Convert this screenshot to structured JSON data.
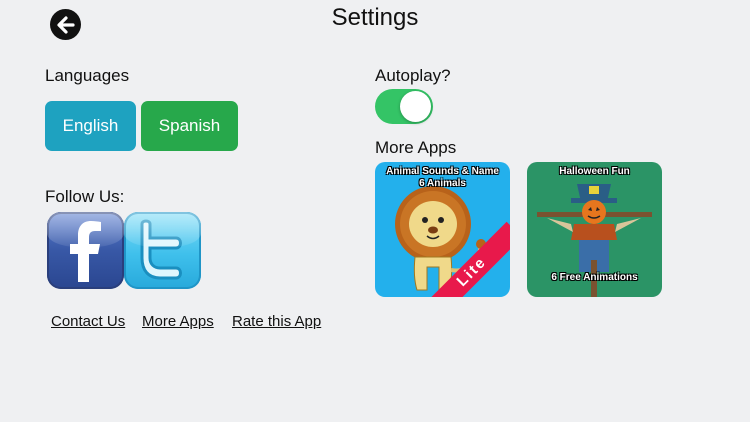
{
  "header": {
    "title": "Settings"
  },
  "languages": {
    "label": "Languages",
    "options": [
      "English",
      "Spanish"
    ]
  },
  "follow": {
    "label": "Follow Us:"
  },
  "links": [
    "Contact Us",
    "More Apps",
    "Rate this App"
  ],
  "autoplay": {
    "label": "Autoplay?",
    "enabled": true
  },
  "more_apps": {
    "label": "More Apps",
    "apps": [
      {
        "line1": "Animal Sounds & Name",
        "line2": "6 Animals",
        "ribbon": "Lite"
      },
      {
        "line1": "Halloween Fun",
        "line2": "6 Free Animations"
      }
    ]
  },
  "colors": {
    "background": "#eff0f2",
    "english_button": "#1ea2c0",
    "spanish_button": "#27a84b",
    "toggle_on": "#34c466"
  },
  "icons": [
    "back-arrow-icon",
    "facebook-icon",
    "twitter-icon"
  ]
}
